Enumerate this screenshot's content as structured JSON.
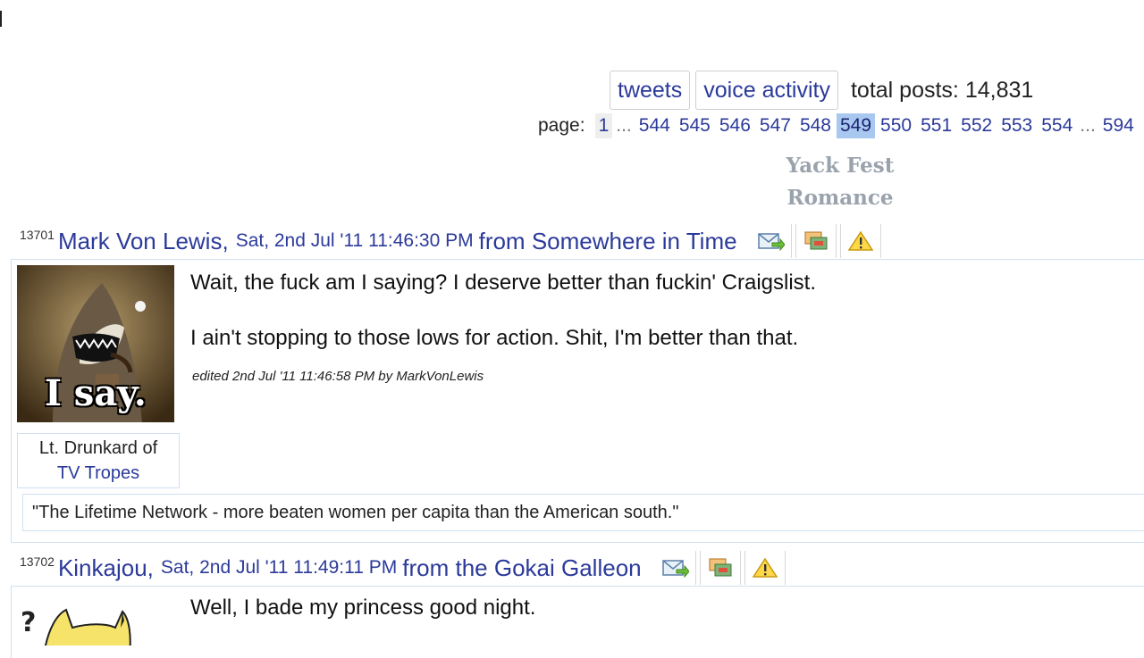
{
  "toolbar": {
    "tweets_label": "tweets",
    "voice_label": "voice activity",
    "total_posts": "total posts: 14,831"
  },
  "pager": {
    "label": "page:",
    "first": "1",
    "ellipsis": "...",
    "pages": [
      "544",
      "545",
      "546",
      "547",
      "548",
      "549",
      "550",
      "551",
      "552",
      "553",
      "554"
    ],
    "current": "549",
    "last": "594"
  },
  "forum": {
    "title_line1": "Yack Fest",
    "title_line2": "Romance"
  },
  "posts": [
    {
      "number": "13701",
      "author": "Mark Von Lewis,",
      "date": "Sat, 2nd Jul '11 11:46:30 PM",
      "from": "from Somewhere in Time",
      "avatar_caption": "I say.",
      "user_title": "Lt. Drunkard of",
      "user_title_link": "TV Tropes",
      "lines": [
        "Wait, the fuck am I saying? I deserve better than fuckin' Craigslist.",
        "I ain't stopping to those lows for action. Shit, I'm better than that."
      ],
      "edited": "edited 2nd Jul '11 11:46:58 PM by MarkVonLewis",
      "signature": "\"The Lifetime Network - more beaten women per capita than the American south.\""
    },
    {
      "number": "13702",
      "author": "Kinkajou,",
      "date": "Sat, 2nd Jul '11 11:49:11 PM",
      "from": "from the Gokai Galleon",
      "lines": [
        "Well, I bade my princess good night."
      ]
    }
  ],
  "icons": {
    "message": "envelope-arrow-icon",
    "quote": "quote-icon",
    "report": "warning-icon"
  }
}
